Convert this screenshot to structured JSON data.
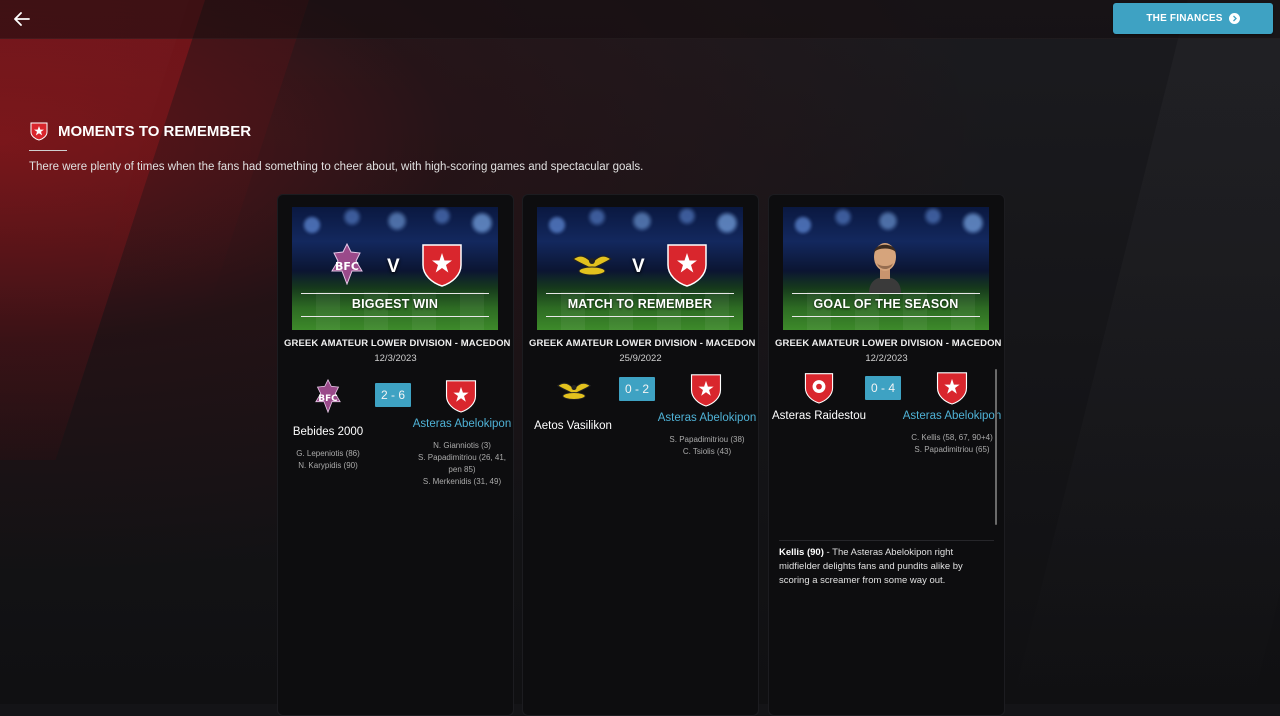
{
  "header": {
    "back_icon": "arrow-left-icon",
    "finances_label": "THE FINANCES",
    "finances_icon": "chevron-right-circle-icon",
    "accent_color": "#3ea2c3"
  },
  "section": {
    "title": "MOMENTS TO REMEMBER",
    "description": "There were plenty of times when the fans had something to cheer about, with high-scoring games and spectacular goals."
  },
  "cards": [
    {
      "caption": "BIGGEST WIN",
      "vs": "V",
      "competition": "GREEK AMATEUR LOWER DIVISION - MACEDONI",
      "date": "12/3/2023",
      "score": "2 - 6",
      "home": {
        "name": "Bebides 2000",
        "scorers": [
          "G. Lepeniotis (86)",
          "N. Karypidis (90)"
        ]
      },
      "away": {
        "name": "Asteras Abelokipon",
        "scorers": [
          "N. Gianniotis (3)",
          "S. Papadimitriou (26, 41, pen 85)",
          "S. Merkenidis (31, 49)"
        ]
      }
    },
    {
      "caption": "MATCH TO REMEMBER",
      "vs": "V",
      "competition": "GREEK AMATEUR LOWER DIVISION - MACEDONI",
      "date": "25/9/2022",
      "score": "0 - 2",
      "home": {
        "name": "Aetos Vasilikon",
        "scorers": []
      },
      "away": {
        "name": "Asteras Abelokipon",
        "scorers": [
          "S. Papadimitriou (38)",
          "C. Tsiolis (43)"
        ]
      }
    },
    {
      "caption": "GOAL OF THE SEASON",
      "competition": "GREEK AMATEUR LOWER DIVISION - MACEDONI",
      "date": "12/2/2023",
      "score": "0 - 4",
      "home": {
        "name": "Asteras Raidestou",
        "scorers": []
      },
      "away": {
        "name": "Asteras Abelokipon",
        "scorers": [
          "C. Kellis (58, 67, 90+4)",
          "S. Papadimitriou (65)"
        ]
      },
      "goal_player": "Kellis (90)",
      "goal_text": " - The Asteras Abelokipon right midfielder delights fans and pundits alike by scoring a screamer from some way out."
    }
  ]
}
